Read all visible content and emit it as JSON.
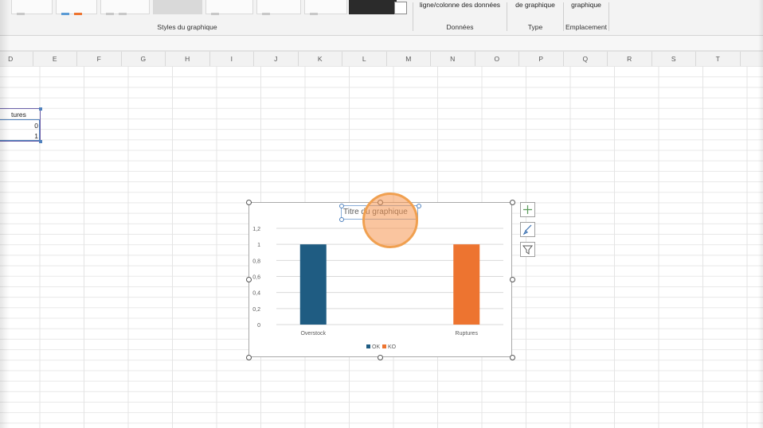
{
  "ribbon": {
    "groups": [
      {
        "label": "Styles du graphique"
      },
      {
        "top": "ligne/colonne  des données",
        "label": "Données"
      },
      {
        "top": "de graphique",
        "label": "Type"
      },
      {
        "top": "graphique",
        "label": "Emplacement"
      }
    ]
  },
  "columns": [
    "D",
    "E",
    "F",
    "G",
    "H",
    "I",
    "J",
    "K",
    "L",
    "M",
    "N",
    "O",
    "P",
    "Q",
    "R",
    "S",
    "T"
  ],
  "cells": {
    "header_ruptures": "tures",
    "val1": "0",
    "val2": "1"
  },
  "chart": {
    "title": "Titre du graphique",
    "side_buttons": [
      "plus-icon",
      "brush-icon",
      "filter-icon"
    ],
    "colors": {
      "OK": "#1f5c82",
      "KO": "#ed7430"
    }
  },
  "chart_data": {
    "type": "bar",
    "title": "Titre du graphique",
    "categories": [
      "Overstock",
      "Ruptures"
    ],
    "series": [
      {
        "name": "OK",
        "values": [
          1,
          0
        ]
      },
      {
        "name": "KO",
        "values": [
          0,
          1
        ]
      }
    ],
    "ylim": [
      0,
      1.2
    ],
    "yticks": [
      "0",
      "0,2",
      "0,4",
      "0,6",
      "0,8",
      "1",
      "1,2"
    ],
    "xlabel": "",
    "ylabel": "",
    "grid": true,
    "legend": "bottom"
  }
}
